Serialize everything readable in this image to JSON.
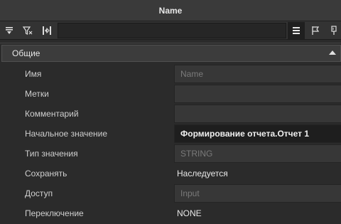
{
  "window": {
    "title": "Name"
  },
  "toolbar": {
    "buttons": [
      {
        "icon": "sort-down-icon"
      },
      {
        "icon": "filter-icon"
      },
      {
        "icon": "expand-icon"
      },
      {
        "icon": "list-view-icon"
      },
      {
        "icon": "flag-icon"
      },
      {
        "icon": "pin-icon"
      }
    ],
    "search_value": ""
  },
  "section": {
    "label": "Общие",
    "expanded": true,
    "rows": [
      {
        "name": "Имя",
        "value": "Name",
        "style": "placeholder"
      },
      {
        "name": "Метки",
        "value": "",
        "style": "field"
      },
      {
        "name": "Комментарий",
        "value": "",
        "style": "field"
      },
      {
        "name": "Начальное значение",
        "value": "Формирование отчета.Отчет 1",
        "style": "bold"
      },
      {
        "name": "Тип значения",
        "value": "STRING",
        "style": "placeholder"
      },
      {
        "name": "Сохранять",
        "value": "Наследуется",
        "style": "plain"
      },
      {
        "name": "Доступ",
        "value": "Input",
        "style": "placeholder"
      },
      {
        "name": "Переключение",
        "value": "NONE",
        "style": "plain"
      }
    ]
  }
}
